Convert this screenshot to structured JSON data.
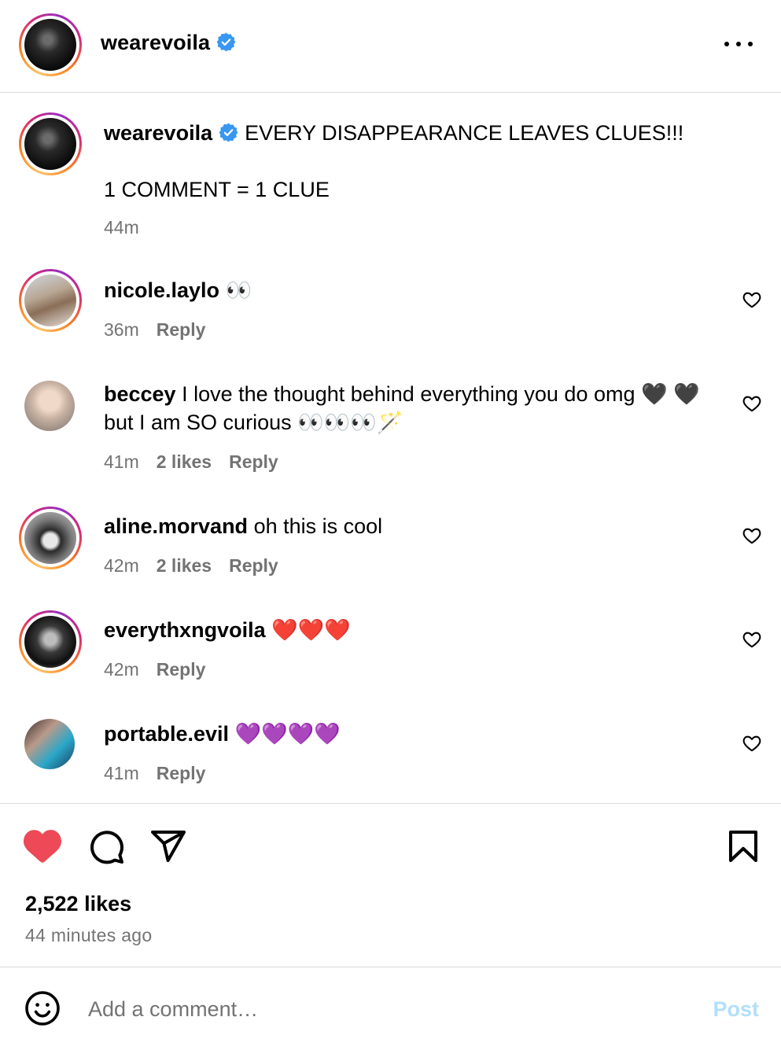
{
  "header": {
    "username": "wearevoila",
    "verified": true,
    "more_icon": "more-horizontal-icon"
  },
  "caption": {
    "username": "wearevoila",
    "verified": true,
    "line1": "EVERY DISAPPEARANCE LEAVES CLUES!!!",
    "line2": "1 COMMENT = 1 CLUE",
    "time": "44m"
  },
  "comments": [
    {
      "username": "nicole.laylo",
      "text": "👀",
      "time": "36m",
      "likes": "",
      "reply": "Reply",
      "story_ring": true
    },
    {
      "username": "beccey",
      "text": "I love the thought behind everything you do omg 🖤 🖤 but I am SO curious 👀👀👀🪄",
      "time": "41m",
      "likes": "2 likes",
      "reply": "Reply",
      "story_ring": false
    },
    {
      "username": "aline.morvand",
      "text": "oh this is cool",
      "time": "42m",
      "likes": "2 likes",
      "reply": "Reply",
      "story_ring": true
    },
    {
      "username": "everythxngvoila",
      "text": "❤️❤️❤️",
      "time": "42m",
      "likes": "",
      "reply": "Reply",
      "story_ring": true
    },
    {
      "username": "portable.evil",
      "text": "💜💜💜💜",
      "time": "41m",
      "likes": "",
      "reply": "Reply",
      "story_ring": false
    }
  ],
  "actions": {
    "liked": true,
    "like_color": "#ed4956",
    "like_icon": "heart-filled-icon",
    "comment_icon": "comment-bubble-icon",
    "share_icon": "paper-plane-icon",
    "save_icon": "bookmark-icon",
    "likes_count": "2,522 likes",
    "time_ago": "44 minutes ago"
  },
  "composer": {
    "emoji_icon": "smiley-icon",
    "placeholder": "Add a comment…",
    "value": "",
    "post_label": "Post",
    "post_color": "#b2dffc"
  },
  "colors": {
    "verified_blue": "#3897f0",
    "secondary_text": "#737373",
    "divider": "#dbdbdb"
  }
}
